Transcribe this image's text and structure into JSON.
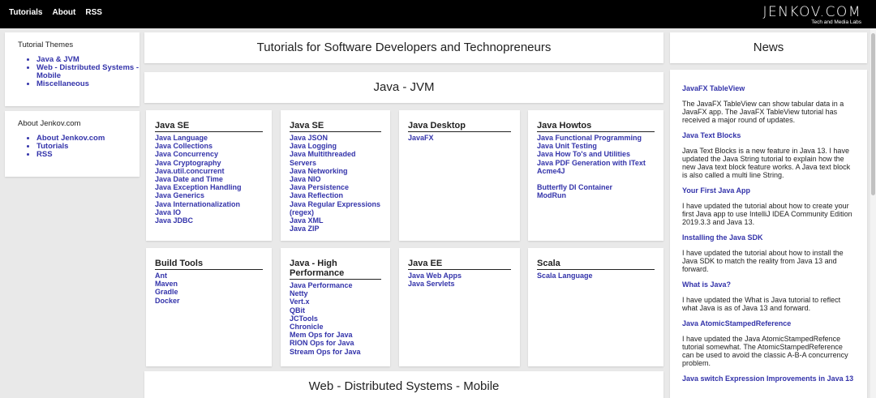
{
  "topnav": [
    "Tutorials",
    "About",
    "RSS"
  ],
  "logo": {
    "brand": "JENKOV.COM",
    "tagline": "Tech and Media Labs"
  },
  "sidebar": {
    "themes": {
      "title": "Tutorial Themes",
      "items": [
        "Java & JVM",
        "Web - Distributed Systems - Mobile",
        "Miscellaneous"
      ]
    },
    "about": {
      "title": "About Jenkov.com",
      "items": [
        "About Jenkov.com",
        "Tutorials",
        "RSS"
      ]
    }
  },
  "main": {
    "title": "Tutorials for Software Developers and Technopreneurs",
    "section1": "Java - JVM",
    "section2": "Web - Distributed Systems - Mobile",
    "cards": [
      {
        "title": "Java SE",
        "links": [
          "Java Language",
          "Java Collections",
          "Java Concurrency",
          "Java Cryptography",
          "Java.util.concurrent",
          "Java Date and Time",
          "Java Exception Handling",
          "Java Generics",
          "Java Internationalization",
          "Java IO",
          "Java JDBC"
        ]
      },
      {
        "title": "Java SE",
        "links": [
          "Java JSON",
          "Java Logging",
          "Java Multithreaded Servers",
          "Java Networking",
          "Java NIO",
          "Java Persistence",
          "Java Reflection",
          "Java Regular Expressions (regex)",
          "Java XML",
          "Java ZIP"
        ]
      },
      {
        "title": "Java Desktop",
        "links": [
          "JavaFX"
        ]
      },
      {
        "title": "Java Howtos",
        "links": [
          "Java Functional Programming",
          "Java Unit Testing",
          "Java How To's and Utilities",
          "Java PDF Generation with IText",
          "Acme4J",
          "",
          "Butterfly DI Container",
          "ModRun"
        ]
      },
      {
        "title": "Build Tools",
        "links": [
          "Ant",
          "Maven",
          "Gradle",
          "Docker"
        ]
      },
      {
        "title": "Java - High Performance",
        "links": [
          "Java Performance",
          "Netty",
          "Vert.x",
          "QBit",
          "JCTools",
          "Chronicle",
          "Mem Ops for Java",
          "RION Ops for Java",
          "Stream Ops for Java"
        ]
      },
      {
        "title": "Java EE",
        "links": [
          "Java Web Apps",
          "Java Servlets"
        ]
      },
      {
        "title": "Scala",
        "links": [
          "Scala Language"
        ]
      }
    ]
  },
  "news": {
    "title": "News",
    "items": [
      {
        "title": "JavaFX TableView",
        "text": "The JavaFX TableView can show tabular data in a JavaFX app. The JavaFX TableView tutorial has received a major round of updates."
      },
      {
        "title": "Java Text Blocks",
        "text": "Java Text Blocks is a new feature in Java 13. I have updated the Java String tutorial to explain how the new Java text block feature works. A Java text block is also called a multi line String."
      },
      {
        "title": "Your First Java App",
        "text": "I have updated the tutorial about how to create your first Java app to use IntelliJ IDEA Community Edition 2019.3.3 and Java 13."
      },
      {
        "title": "Installing the Java SDK",
        "text": "I have updated the tutorial about how to install the Java SDK to match the reality from Java 13 and forward."
      },
      {
        "title": "What is Java?",
        "text": "I have updated the What is Java tutorial to reflect what Java is as of Java 13 and forward."
      },
      {
        "title": "Java AtomicStampedReference",
        "text": "I have updated the Java AtomicStampedRefence tutorial somewhat. The AtomicStampedReference can be used to avoid the classic A-B-A concurrency problem."
      },
      {
        "title": "Java switch Expression Improvements in Java 13",
        "text": ""
      }
    ]
  }
}
